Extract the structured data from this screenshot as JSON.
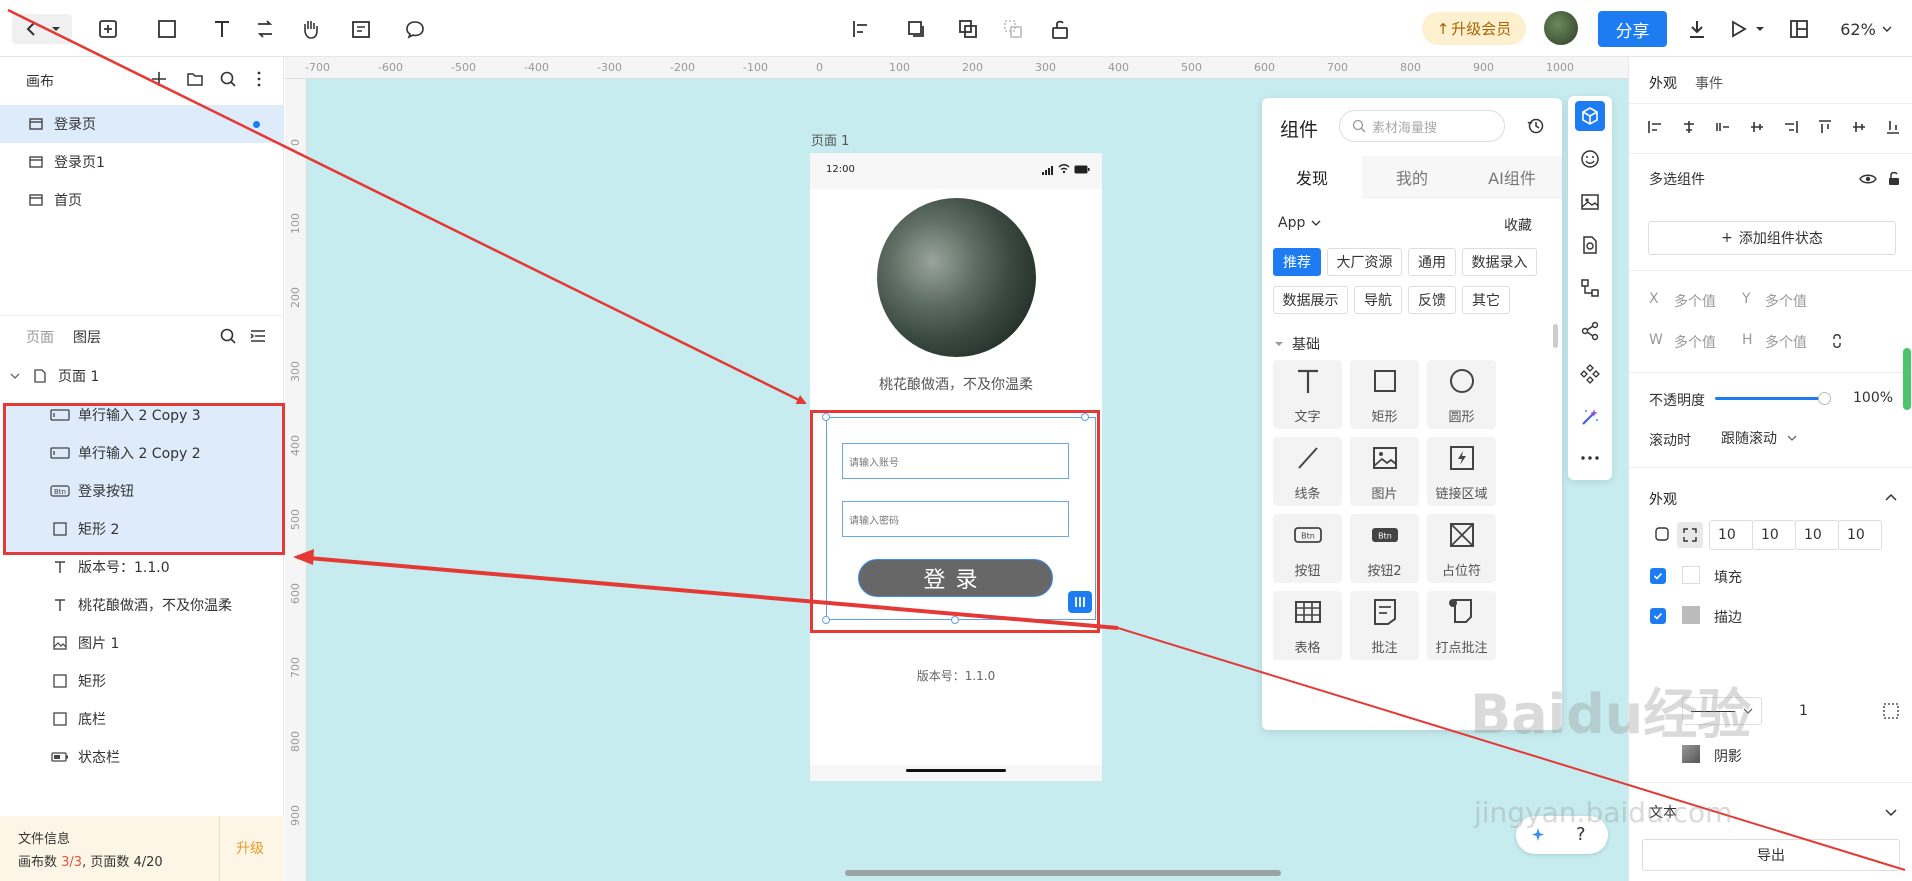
{
  "toolbar": {
    "upgrade": "升级会员",
    "share": "分享",
    "zoom": "62%"
  },
  "left": {
    "canvas_title": "画布",
    "pages": [
      {
        "label": "登录页"
      },
      {
        "label": "登录页1"
      },
      {
        "label": "首页"
      }
    ],
    "tab_pages": "页面",
    "tab_layers": "图层",
    "root": "页面 1",
    "layers": [
      {
        "label": "单行输入 2 Copy 3"
      },
      {
        "label": "单行输入 2 Copy 2"
      },
      {
        "label": "登录按钮"
      },
      {
        "label": "矩形 2"
      },
      {
        "label": "版本号：1.1.0"
      },
      {
        "label": "桃花酿做酒，不及你温柔"
      },
      {
        "label": "图片 1"
      },
      {
        "label": "矩形"
      },
      {
        "label": "底栏"
      },
      {
        "label": "状态栏"
      }
    ],
    "file_info": {
      "title": "文件信息",
      "canvas_count_label": "画布数",
      "canvas_count": "3/3",
      "page_count_label": "页面数",
      "page_count": "4/20",
      "upgrade": "升级"
    }
  },
  "ruler": {
    "h_ticks": [
      "-700",
      "-600",
      "-500",
      "-400",
      "-300",
      "-200",
      "-100",
      "0",
      "100",
      "200",
      "300",
      "400",
      "500",
      "600",
      "700",
      "800",
      "900",
      "1000"
    ],
    "v_ticks": [
      "0",
      "100",
      "200",
      "300",
      "400",
      "500",
      "600",
      "700",
      "800",
      "900"
    ]
  },
  "phone": {
    "frame_label": "页面 1",
    "time": "12:00",
    "slogan": "桃花酿做酒，不及你温柔",
    "account_placeholder": "请输入账号",
    "password_placeholder": "请输入密码",
    "login": "登录",
    "version": "版本号：1.1.0"
  },
  "components": {
    "title": "组件",
    "search_placeholder": "素材海量搜",
    "tabs": [
      "发现",
      "我的",
      "AI组件"
    ],
    "app_select": "App",
    "favorites": "收藏",
    "tags_row1": [
      "推荐",
      "大厂资源",
      "通用",
      "数据录入"
    ],
    "tags_row2": [
      "数据展示",
      "导航",
      "反馈",
      "其它"
    ],
    "section": "基础",
    "tiles": [
      {
        "label": "文字",
        "icon": "text-icon"
      },
      {
        "label": "矩形",
        "icon": "rectangle-icon"
      },
      {
        "label": "圆形",
        "icon": "circle-icon"
      },
      {
        "label": "线条",
        "icon": "line-icon"
      },
      {
        "label": "图片",
        "icon": "image-icon"
      },
      {
        "label": "链接区域",
        "icon": "link-area-icon"
      },
      {
        "label": "按钮",
        "icon": "button-icon"
      },
      {
        "label": "按钮2",
        "icon": "button2-icon"
      },
      {
        "label": "占位符",
        "icon": "placeholder-icon"
      },
      {
        "label": "表格",
        "icon": "table-icon"
      },
      {
        "label": "批注",
        "icon": "comment-icon"
      },
      {
        "label": "打点批注",
        "icon": "pin-comment-icon"
      }
    ],
    "btn_glyph": "Btn"
  },
  "right": {
    "tab_appearance": "外观",
    "tab_events": "事件",
    "multi_select": "多选组件",
    "add_state": "添加组件状态",
    "x_label": "X",
    "x_value": "多个值",
    "y_label": "Y",
    "y_value": "多个值",
    "w_label": "W",
    "w_value": "多个值",
    "h_label": "H",
    "h_value": "多个值",
    "opacity_label": "不透明度",
    "opacity_value": "100%",
    "opacity_fraction": 1.0,
    "scroll_label": "滚动时",
    "scroll_value": "跟随滚动",
    "appearance_title": "外观",
    "radius": [
      "10",
      "10",
      "10",
      "10"
    ],
    "fill_label": "填充",
    "stroke_label": "描边",
    "stroke_width": "1",
    "shadow_label": "阴影",
    "text_label": "文本",
    "export": "导出"
  },
  "watermark": {
    "brand": "Baidu经验",
    "url": "jingyan.baidu.com"
  },
  "colors": {
    "accent": "#1d7cf2",
    "canvas_bg": "#c6ecef",
    "annotation": "#e53935"
  }
}
